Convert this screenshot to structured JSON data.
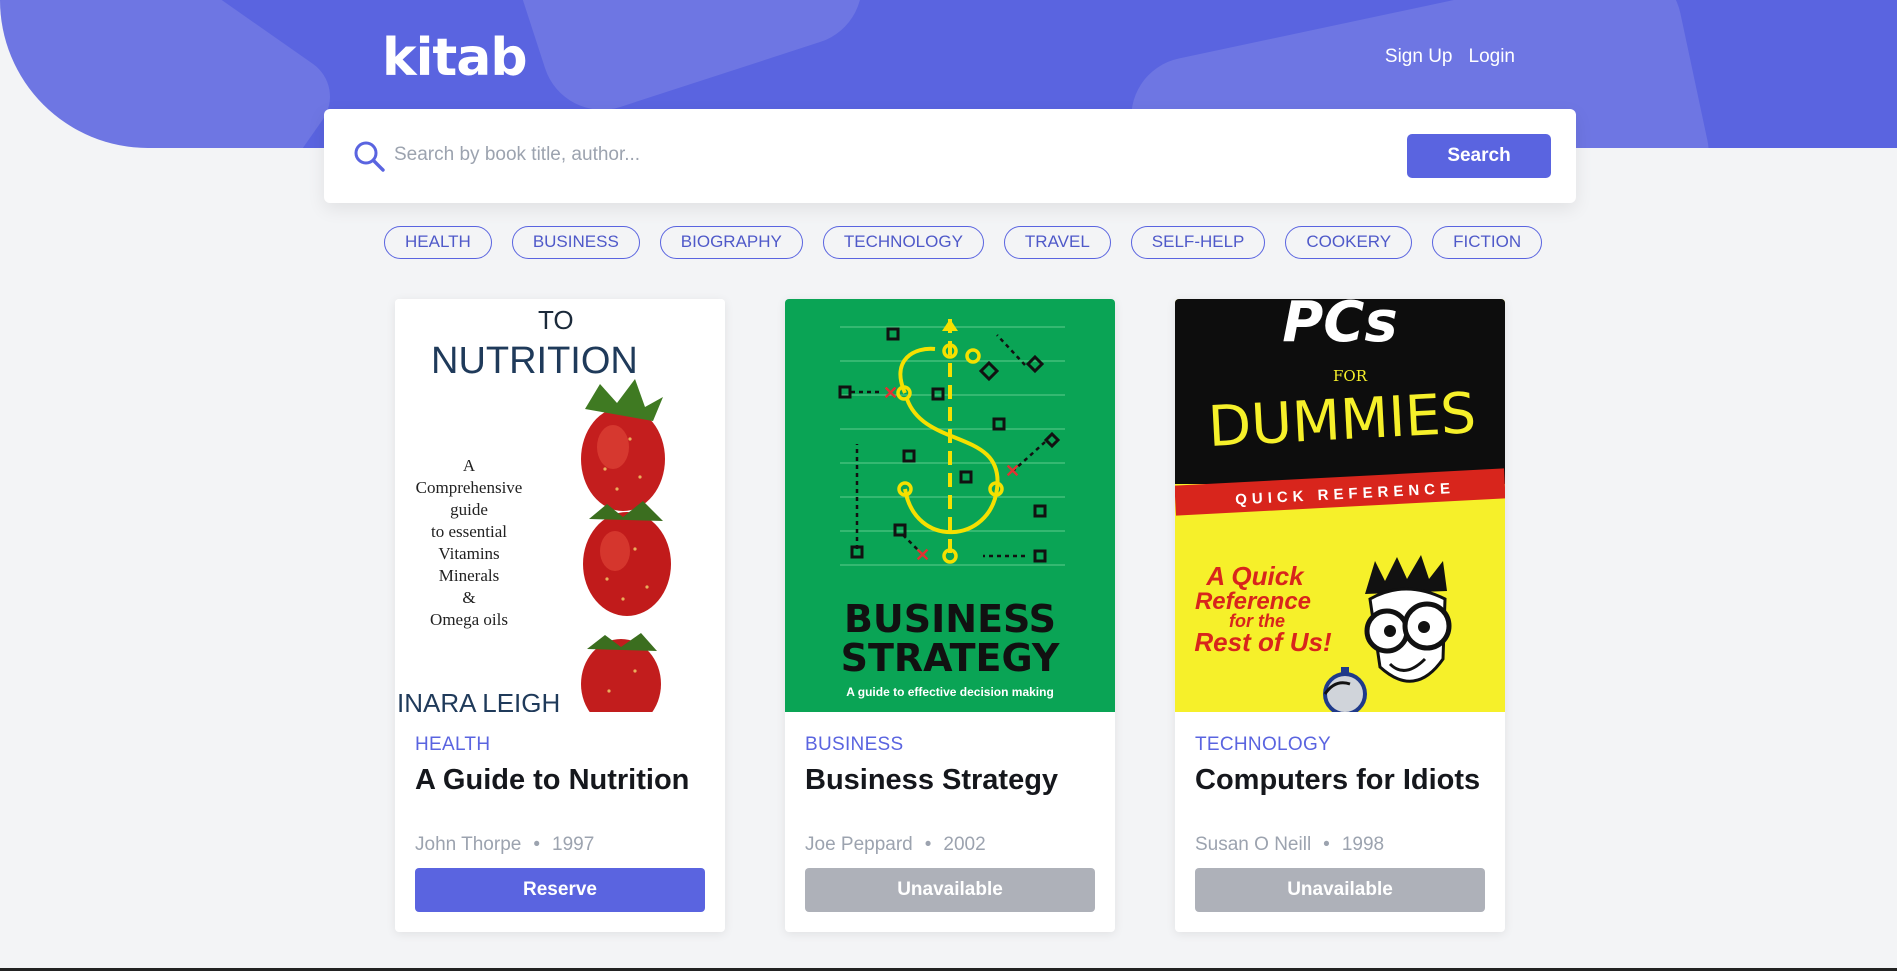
{
  "brand": {
    "logo": "kitab"
  },
  "nav": {
    "signup": "Sign Up",
    "login": "Login"
  },
  "search": {
    "placeholder": "Search by book title, author...",
    "button": "Search"
  },
  "categories": [
    "HEALTH",
    "BUSINESS",
    "BIOGRAPHY",
    "TECHNOLOGY",
    "TRAVEL",
    "SELF-HELP",
    "COOKERY",
    "FICTION"
  ],
  "books": [
    {
      "category": "HEALTH",
      "title": "A Guide to Nutrition",
      "author": "John Thorpe",
      "year": "1997",
      "action": "Reserve",
      "available": true,
      "cover": {
        "top": "TO",
        "title": "NUTRITION",
        "blurb": [
          "A",
          "Comprehensive",
          "guide",
          "to essential",
          "Vitamins",
          "Minerals",
          "&",
          "Omega oils"
        ],
        "bottom": "INARA LEIGH"
      }
    },
    {
      "category": "BUSINESS",
      "title": "Business Strategy",
      "author": "Joe Peppard",
      "year": "2002",
      "action": "Unavailable",
      "available": false,
      "cover": {
        "line1": "BUSINESS",
        "line2": "STRATEGY",
        "subtitle": "A guide to effective decision making"
      }
    },
    {
      "category": "TECHNOLOGY",
      "title": "Computers for Idiots",
      "author": "Susan O Neill",
      "year": "1998",
      "action": "Unavailable",
      "available": false,
      "cover": {
        "top": "PCs",
        "for": "FOR",
        "dummies": "DUMMIES",
        "band": "QUICK REFERENCE",
        "tag1": "A Quick",
        "tag2": "Reference",
        "tag3": "for the",
        "tag4": "Rest of Us!"
      }
    }
  ],
  "meta_separator": "•",
  "colors": {
    "accent": "#5a64e0",
    "disabled": "#aeb1b9",
    "page_bg": "#f3f4f6"
  }
}
